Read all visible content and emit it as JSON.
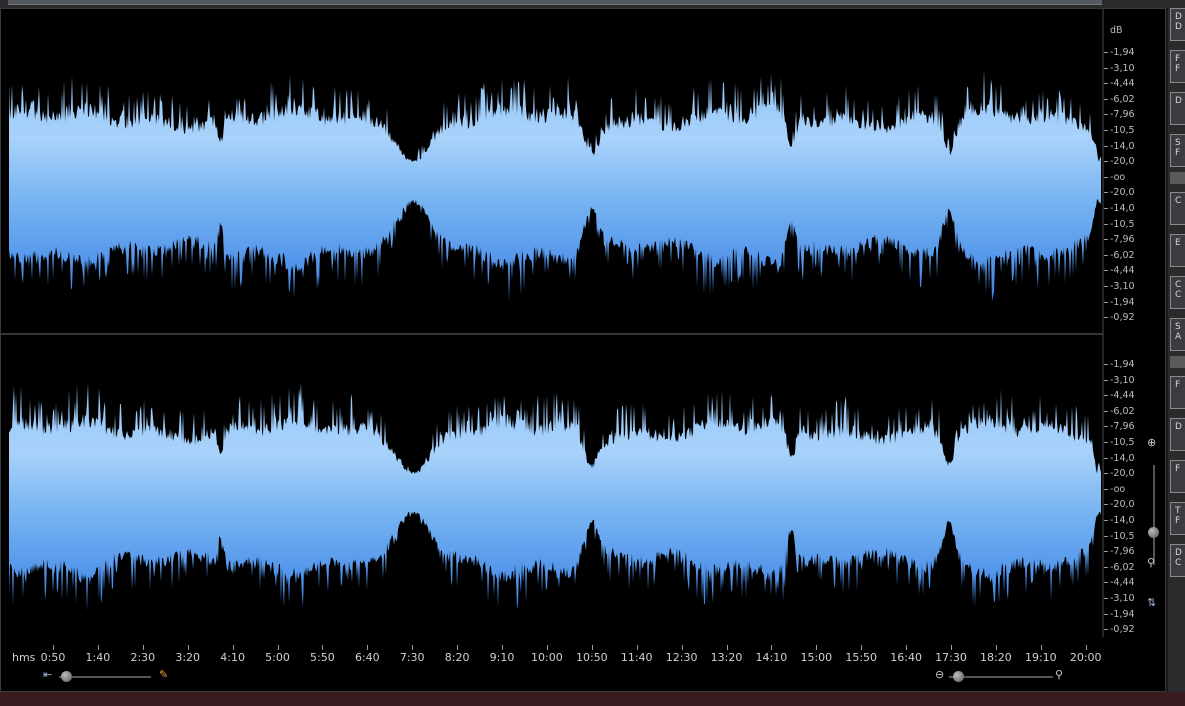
{
  "db_axis": {
    "unit": "dB",
    "upper_channel_ticks": [
      "-1,94",
      "-3,10",
      "-4,44",
      "-6,02",
      "-7,96",
      "-10,5",
      "-14,0",
      "-20,0",
      "-oo",
      "-20,0",
      "-14,0",
      "-10,5",
      "-7,96",
      "-6,02",
      "-4,44",
      "-3,10",
      "-1,94",
      "-0,92"
    ],
    "lower_channel_ticks": [
      "-1,94",
      "-3,10",
      "-4,44",
      "-6,02",
      "-7,96",
      "-10,5",
      "-14,0",
      "-20,0",
      "-oo",
      "-20,0",
      "-14,0",
      "-10,5",
      "-7,96",
      "-6,02",
      "-4,44",
      "-3,10",
      "-1,94",
      "-0,92"
    ]
  },
  "timeline": {
    "unit_label": "hms",
    "labels": [
      "0:50",
      "1:40",
      "2:30",
      "3:20",
      "4:10",
      "5:00",
      "5:50",
      "6:40",
      "7:30",
      "8:20",
      "9:10",
      "10:00",
      "10:50",
      "11:40",
      "12:30",
      "13:20",
      "14:10",
      "15:00",
      "15:50",
      "16:40",
      "17:30",
      "18:20",
      "19:10",
      "20:00"
    ]
  },
  "waveform": {
    "channels": 2,
    "colors": {
      "light": "#a9d2fb",
      "mid": "#7ab6f2",
      "dark": "#3c82e6",
      "background": "#000000"
    }
  },
  "sidebar_buttons": [
    {
      "label": "D\nD"
    },
    {
      "label": "F\nF"
    },
    {
      "label": "D"
    },
    {
      "label": "S\nF"
    },
    {
      "label": "C"
    },
    {
      "label": "E"
    },
    {
      "label": "C\nC"
    },
    {
      "label": "S\nA"
    },
    {
      "label": "F"
    },
    {
      "label": "D"
    },
    {
      "label": "F"
    },
    {
      "label": "T\nF"
    },
    {
      "label": "D\nC"
    }
  ],
  "icons": {
    "zoom_in": "zoom-in-icon",
    "zoom_out": "zoom-out-icon",
    "zoom_fit": "zoom-fit-icon",
    "scroll_home": "scroll-home-icon",
    "pencil_tool": "pencil-icon"
  }
}
